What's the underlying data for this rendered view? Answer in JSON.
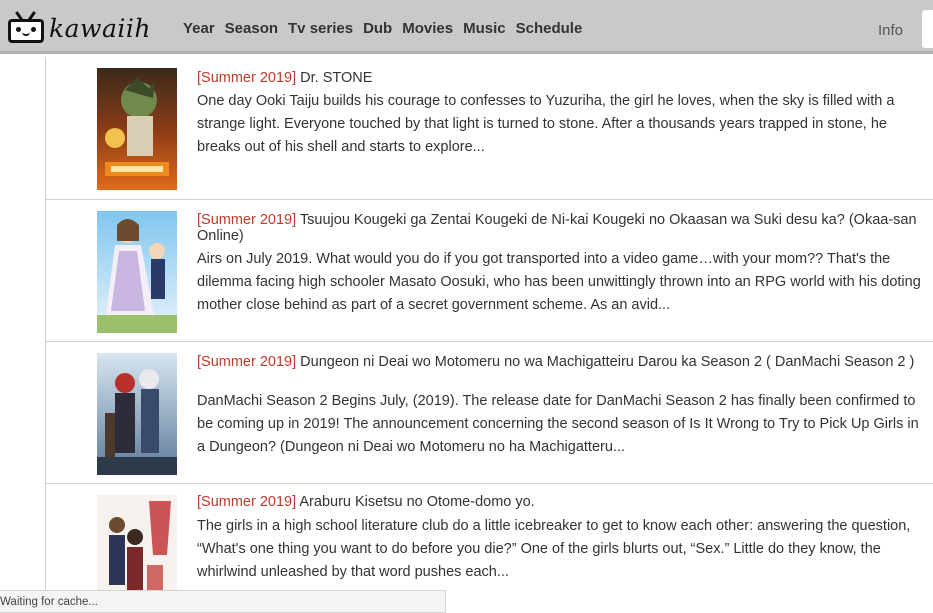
{
  "header": {
    "logo_text": "kawaiih",
    "nav": [
      "Year",
      "Season",
      "Tv series",
      "Dub",
      "Movies",
      "Music",
      "Schedule"
    ],
    "info_label": "Info"
  },
  "items": [
    {
      "season": "[Summer 2019]",
      "title": "Dr. STONE",
      "description": "One day Ooki Taiju builds his courage to confesses to Yuzuriha, the girl he loves, when the sky is filled with a strange light. Everyone touched by that light is turned to stone. After a thousands years trapped in stone, he breaks out of his shell and starts to explore..."
    },
    {
      "season": "[Summer 2019]",
      "title": "Tsuujou Kougeki ga Zentai Kougeki de Ni-kai Kougeki no Okaasan wa Suki desu ka? (Okaa-san Online)",
      "description": "Airs on July 2019. What would you do if you got transported into a video game…with your mom?? That's the dilemma facing high schooler Masato Oosuki, who has been unwittingly thrown into an RPG world with his doting mother close behind as part of a secret government scheme. As an avid..."
    },
    {
      "season": "[Summer 2019]",
      "title": "Dungeon ni Deai wo Motomeru no wa Machigatteiru Darou ka Season 2 ( DanMachi Season 2 )",
      "description": "DanMachi Season 2 Begins July, (2019). The release date for DanMachi Season 2 has finally been confirmed to be coming up in 2019! The announcement concerning the second season of Is It Wrong to Try to Pick Up Girls in a Dungeon? (Dungeon ni Deai wo Motomeru no ha Machigatteru..."
    },
    {
      "season": "[Summer 2019]",
      "title": "Araburu Kisetsu no Otome-domo yo.",
      "description": "The girls in a high school literature club do a little icebreaker to get to know each other: answering the question, “What's one thing you want to do before you die?” One of the girls blurts out, “Sex.” Little do they know, the whirlwind unleashed by that word pushes each..."
    }
  ],
  "status_text": "Waiting for cache...",
  "colors": {
    "header_bg": "#c9c9c9",
    "season_red": "#c0392b"
  }
}
